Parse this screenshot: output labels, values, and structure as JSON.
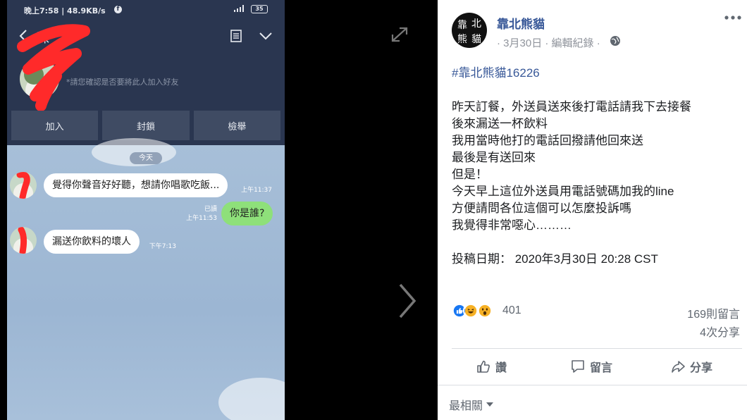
{
  "phone": {
    "status_time": "晚上7:58 | 48.9KB/s",
    "status_fb": "f",
    "battery": "35",
    "contact_name": "陳",
    "confirm_note": "*請您確認是否要將此人加入好友",
    "actions": [
      "加入",
      "封鎖",
      "檢舉"
    ],
    "date_pill": "今天",
    "messages": [
      {
        "text": "覺得你聲音好好聽，想請你唱歌吃飯...",
        "time": "上午11:37"
      },
      {
        "text": "你是誰?",
        "read": "已讀",
        "time": "上午11:53"
      },
      {
        "text": "漏送你飲料的壞人",
        "time": "下午7:13"
      }
    ]
  },
  "viewer": {
    "expand_icon": "expand-arrows-icon",
    "next_icon": "chevron-right-icon"
  },
  "post": {
    "page_name": "靠北熊貓",
    "avatar_chars": [
      "靠",
      "北",
      "熊",
      "貓"
    ],
    "meta": "· 3月30日 · 編輯紀錄 ·",
    "hashtag": "#靠北熊貓16226",
    "lines": [
      "昨天訂餐，外送員送來後打電話請我下去接餐",
      "後來漏送一杯飲料",
      "我用當時他打的電話回撥請他回來送",
      "最後是有送回來",
      "但是！",
      "今天早上這位外送員用電話號碼加我的line",
      "方便請問各位這個可以怎麼投訴嗎",
      "我覺得非常噁心………"
    ],
    "post_date": "投稿日期： 2020年3月30日 20:28 CST",
    "reaction_count": "401",
    "comments": "169則留言",
    "shares": "4次分享",
    "like_label": "讚",
    "comment_label": "留言",
    "share_label": "分享",
    "sort_label": "最相關",
    "colors": {
      "link": "#385898",
      "like_blue": "#1877f2",
      "haha_yellow": "#f7b125",
      "line_green": "#8ee07a"
    }
  }
}
